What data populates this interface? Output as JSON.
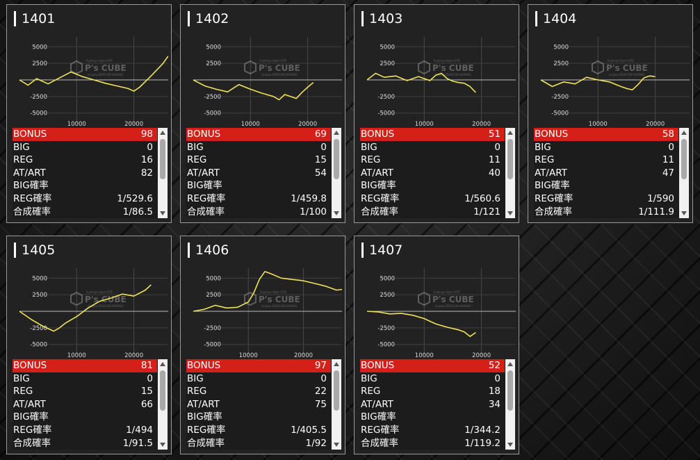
{
  "colors": {
    "line": "#f2e35a",
    "bonus_bg": "#d5201a",
    "panel_bg": "#222222"
  },
  "watermark": {
    "brand": "P's CUBE",
    "tagline": "Fujimiya Style SITE",
    "sub": "sinjuku-ZERO-DE-KARAKU"
  },
  "labels": {
    "bonus": "BONUS",
    "big": "BIG",
    "reg": "REG",
    "at": "AT/ART",
    "big_prob": "BIG確率",
    "reg_prob": "REG確率",
    "total_prob": "合成確率"
  },
  "machines": [
    {
      "id": "1401",
      "bonus": "98",
      "big": "0",
      "reg": "16",
      "at": "82",
      "big_prob": "",
      "reg_prob": "1/529.6",
      "total_prob": "1/86.5"
    },
    {
      "id": "1402",
      "bonus": "69",
      "big": "0",
      "reg": "15",
      "at": "54",
      "big_prob": "",
      "reg_prob": "1/459.8",
      "total_prob": "1/100"
    },
    {
      "id": "1403",
      "bonus": "51",
      "big": "0",
      "reg": "11",
      "at": "40",
      "big_prob": "",
      "reg_prob": "1/560.6",
      "total_prob": "1/121"
    },
    {
      "id": "1404",
      "bonus": "58",
      "big": "0",
      "reg": "11",
      "at": "47",
      "big_prob": "",
      "reg_prob": "1/590",
      "total_prob": "1/111.9"
    },
    {
      "id": "1405",
      "bonus": "81",
      "big": "0",
      "reg": "15",
      "at": "66",
      "big_prob": "",
      "reg_prob": "1/494",
      "total_prob": "1/91.5"
    },
    {
      "id": "1406",
      "bonus": "97",
      "big": "0",
      "reg": "22",
      "at": "75",
      "big_prob": "",
      "reg_prob": "1/405.5",
      "total_prob": "1/92"
    },
    {
      "id": "1407",
      "bonus": "52",
      "big": "0",
      "reg": "18",
      "at": "34",
      "big_prob": "",
      "reg_prob": "1/344.2",
      "total_prob": "1/119.2"
    }
  ],
  "chart_data": [
    {
      "type": "line",
      "title": "1401",
      "x_ticks": [
        "10000",
        "20000"
      ],
      "y_ticks": [
        "5000",
        "2500",
        "-2500",
        "-5000"
      ],
      "xlim": [
        0,
        26000
      ],
      "ylim": [
        -6500,
        6500
      ],
      "x": [
        0,
        1500,
        3000,
        5000,
        7000,
        9000,
        11000,
        13000,
        15000,
        17000,
        19000,
        20000,
        21000,
        23000,
        25000,
        26000
      ],
      "y": [
        0,
        -800,
        200,
        -600,
        300,
        1200,
        500,
        0,
        -500,
        -900,
        -1300,
        -1700,
        -1100,
        600,
        2400,
        3600
      ]
    },
    {
      "type": "line",
      "title": "1402",
      "x_ticks": [
        "10000",
        "20000"
      ],
      "y_ticks": [
        "5000",
        "2500",
        "-2500",
        "-5000"
      ],
      "xlim": [
        0,
        26000
      ],
      "ylim": [
        -6500,
        6500
      ],
      "x": [
        0,
        2000,
        4000,
        6000,
        8000,
        10000,
        12000,
        14000,
        15000,
        16000,
        18000,
        19000,
        20000,
        21000
      ],
      "y": [
        0,
        -900,
        -1400,
        -1800,
        -700,
        -1400,
        -2000,
        -2500,
        -3000,
        -2200,
        -2800,
        -1900,
        -1100,
        -400
      ]
    },
    {
      "type": "line",
      "title": "1403",
      "x_ticks": [
        "10000",
        "20000"
      ],
      "y_ticks": [
        "5000",
        "2500",
        "-2500",
        "-5000"
      ],
      "xlim": [
        0,
        26000
      ],
      "ylim": [
        -6500,
        6500
      ],
      "x": [
        0,
        1500,
        3000,
        5000,
        7000,
        9000,
        11000,
        12000,
        13000,
        14000,
        15000,
        16000,
        17000,
        18000,
        19000
      ],
      "y": [
        0,
        1000,
        400,
        600,
        -100,
        500,
        -100,
        700,
        1000,
        200,
        -200,
        -400,
        -500,
        -1000,
        -1900
      ]
    },
    {
      "type": "line",
      "title": "1404",
      "x_ticks": [
        "10000",
        "20000"
      ],
      "y_ticks": [
        "5000",
        "2500",
        "-2500",
        "-5000"
      ],
      "xlim": [
        0,
        26000
      ],
      "ylim": [
        -6500,
        6500
      ],
      "x": [
        0,
        2000,
        4000,
        6000,
        8000,
        10000,
        12000,
        14000,
        15000,
        16000,
        17000,
        18000,
        19000,
        20000
      ],
      "y": [
        0,
        -1000,
        -300,
        -600,
        400,
        0,
        -300,
        -1000,
        -1300,
        -1500,
        -700,
        300,
        600,
        500
      ]
    },
    {
      "type": "line",
      "title": "1405",
      "x_ticks": [
        "10000",
        "20000"
      ],
      "y_ticks": [
        "5000",
        "2500",
        "-2500",
        "-5000"
      ],
      "xlim": [
        0,
        26000
      ],
      "ylim": [
        -6500,
        6500
      ],
      "x": [
        0,
        2000,
        4000,
        6000,
        7000,
        8000,
        10000,
        12000,
        14000,
        16000,
        18000,
        20000,
        22000,
        23000
      ],
      "y": [
        0,
        -1200,
        -2200,
        -3000,
        -2500,
        -1800,
        -800,
        500,
        1500,
        2000,
        2600,
        2300,
        3200,
        4000
      ]
    },
    {
      "type": "line",
      "title": "1406",
      "x_ticks": [
        "10000",
        "20000"
      ],
      "y_ticks": [
        "5000",
        "2500",
        "-2500",
        "-5000"
      ],
      "xlim": [
        0,
        27000
      ],
      "ylim": [
        -6500,
        6500
      ],
      "x": [
        0,
        2000,
        4000,
        6000,
        8000,
        10000,
        11000,
        12000,
        13000,
        14000,
        16000,
        18000,
        20000,
        22000,
        24000,
        26000,
        27000
      ],
      "y": [
        0,
        300,
        900,
        500,
        600,
        1400,
        2800,
        4800,
        6000,
        5700,
        5000,
        4800,
        4600,
        4200,
        3800,
        3200,
        3300
      ]
    },
    {
      "type": "line",
      "title": "1407",
      "x_ticks": [
        "10000",
        "20000"
      ],
      "y_ticks": [
        "5000",
        "2500",
        "-2500",
        "-5000"
      ],
      "xlim": [
        0,
        26000
      ],
      "ylim": [
        -6500,
        6500
      ],
      "x": [
        0,
        2000,
        4000,
        6000,
        8000,
        10000,
        12000,
        14000,
        16000,
        17000,
        18000,
        19000
      ],
      "y": [
        0,
        -100,
        -400,
        -300,
        -600,
        -1100,
        -1900,
        -2400,
        -2800,
        -3100,
        -3800,
        -3200
      ]
    }
  ]
}
